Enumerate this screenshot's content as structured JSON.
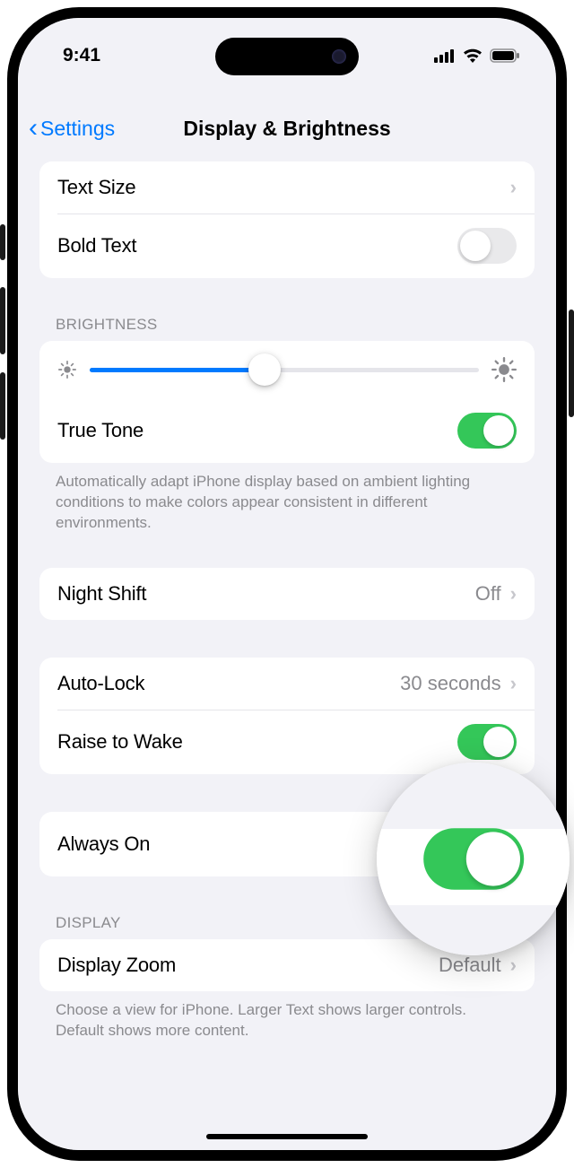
{
  "status": {
    "time": "9:41"
  },
  "nav": {
    "back": "Settings",
    "title": "Display & Brightness"
  },
  "text_group": {
    "text_size": "Text Size",
    "bold_text": "Bold Text"
  },
  "brightness": {
    "header": "BRIGHTNESS",
    "true_tone": "True Tone",
    "footer": "Automatically adapt iPhone display based on ambient lighting conditions to make colors appear consistent in different environments."
  },
  "night_shift": {
    "label": "Night Shift",
    "value": "Off"
  },
  "lock": {
    "auto_lock": "Auto-Lock",
    "auto_lock_value": "30 seconds",
    "raise_to_wake": "Raise to Wake"
  },
  "always_on": {
    "label": "Always On"
  },
  "display": {
    "header": "DISPLAY",
    "zoom": "Display Zoom",
    "zoom_value": "Default",
    "footer": "Choose a view for iPhone. Larger Text shows larger controls. Default shows more content."
  }
}
